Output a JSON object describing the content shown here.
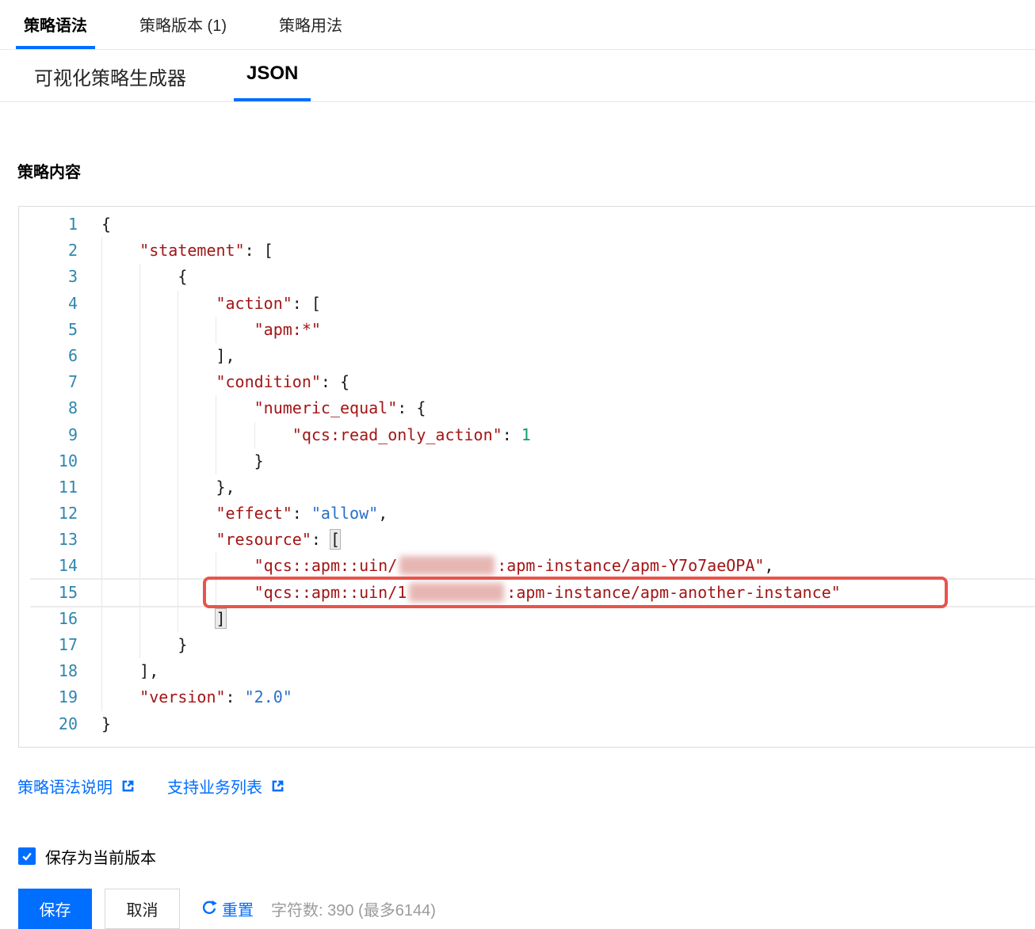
{
  "tabs_primary": [
    {
      "label": "策略语法",
      "active": true
    },
    {
      "label": "策略版本 (1)",
      "active": false
    },
    {
      "label": "策略用法",
      "active": false
    }
  ],
  "tabs_secondary": [
    {
      "label": "可视化策略生成器",
      "active": false
    },
    {
      "label": "JSON",
      "active": true
    }
  ],
  "section_title": "策略内容",
  "editor": {
    "lines": [
      {
        "num": 1,
        "ind": 0,
        "seg": [
          [
            "p",
            "{"
          ]
        ]
      },
      {
        "num": 2,
        "ind": 1,
        "seg": [
          [
            "k",
            "\"statement\""
          ],
          [
            "p",
            ": ["
          ]
        ]
      },
      {
        "num": 3,
        "ind": 2,
        "seg": [
          [
            "p",
            "{"
          ]
        ]
      },
      {
        "num": 4,
        "ind": 3,
        "seg": [
          [
            "k",
            "\"action\""
          ],
          [
            "p",
            ": ["
          ]
        ]
      },
      {
        "num": 5,
        "ind": 4,
        "seg": [
          [
            "k",
            "\"apm:*\""
          ]
        ]
      },
      {
        "num": 6,
        "ind": 3,
        "seg": [
          [
            "p",
            "],"
          ]
        ]
      },
      {
        "num": 7,
        "ind": 3,
        "seg": [
          [
            "k",
            "\"condition\""
          ],
          [
            "p",
            ": {"
          ]
        ]
      },
      {
        "num": 8,
        "ind": 4,
        "seg": [
          [
            "k",
            "\"numeric_equal\""
          ],
          [
            "p",
            ": {"
          ]
        ]
      },
      {
        "num": 9,
        "ind": 5,
        "seg": [
          [
            "k",
            "\"qcs:read_only_action\""
          ],
          [
            "p",
            ": "
          ],
          [
            "n",
            "1"
          ]
        ]
      },
      {
        "num": 10,
        "ind": 4,
        "seg": [
          [
            "p",
            "}"
          ]
        ]
      },
      {
        "num": 11,
        "ind": 3,
        "seg": [
          [
            "p",
            "},"
          ]
        ]
      },
      {
        "num": 12,
        "ind": 3,
        "seg": [
          [
            "k",
            "\"effect\""
          ],
          [
            "p",
            ": "
          ],
          [
            "v",
            "\"allow\""
          ],
          [
            "p",
            ","
          ]
        ]
      },
      {
        "num": 13,
        "ind": 3,
        "seg": [
          [
            "k",
            "\"resource\""
          ],
          [
            "p",
            ": "
          ],
          [
            "m",
            "["
          ]
        ]
      },
      {
        "num": 14,
        "ind": 4,
        "seg": [
          [
            "k",
            "\"qcs::apm::uin/"
          ],
          [
            "blur",
            ""
          ],
          [
            "k",
            ":apm-instance/apm-Y7o7aeOPA\""
          ],
          [
            "p",
            ","
          ]
        ]
      },
      {
        "num": 15,
        "ind": 4,
        "highlight": true,
        "seg": [
          [
            "k",
            "\"qcs::apm::uin/1"
          ],
          [
            "blur",
            ""
          ],
          [
            "k",
            ":apm-instance/apm-another-instance\""
          ]
        ]
      },
      {
        "num": 16,
        "ind": 3,
        "seg": [
          [
            "m",
            "]"
          ]
        ]
      },
      {
        "num": 17,
        "ind": 2,
        "seg": [
          [
            "p",
            "}"
          ]
        ]
      },
      {
        "num": 18,
        "ind": 1,
        "seg": [
          [
            "p",
            "],"
          ]
        ]
      },
      {
        "num": 19,
        "ind": 1,
        "seg": [
          [
            "k",
            "\"version\""
          ],
          [
            "p",
            ": "
          ],
          [
            "v",
            "\"2.0\""
          ]
        ]
      },
      {
        "num": 20,
        "ind": 0,
        "seg": [
          [
            "p",
            "}"
          ]
        ]
      }
    ]
  },
  "links": [
    {
      "label": "策略语法说明",
      "icon": "external-link-icon"
    },
    {
      "label": "支持业务列表",
      "icon": "external-link-icon"
    }
  ],
  "save_version_checkbox": {
    "label": "保存为当前版本",
    "checked": true
  },
  "actions": {
    "save": "保存",
    "cancel": "取消",
    "reset": "重置"
  },
  "char_count": "字符数: 390 (最多6144)",
  "colors": {
    "accent": "#006eff",
    "token_key": "#a31515",
    "token_string_value": "#2770c8",
    "token_number": "#0e9a6c",
    "line_number": "#3086ad",
    "highlight_box": "#e8544c"
  }
}
